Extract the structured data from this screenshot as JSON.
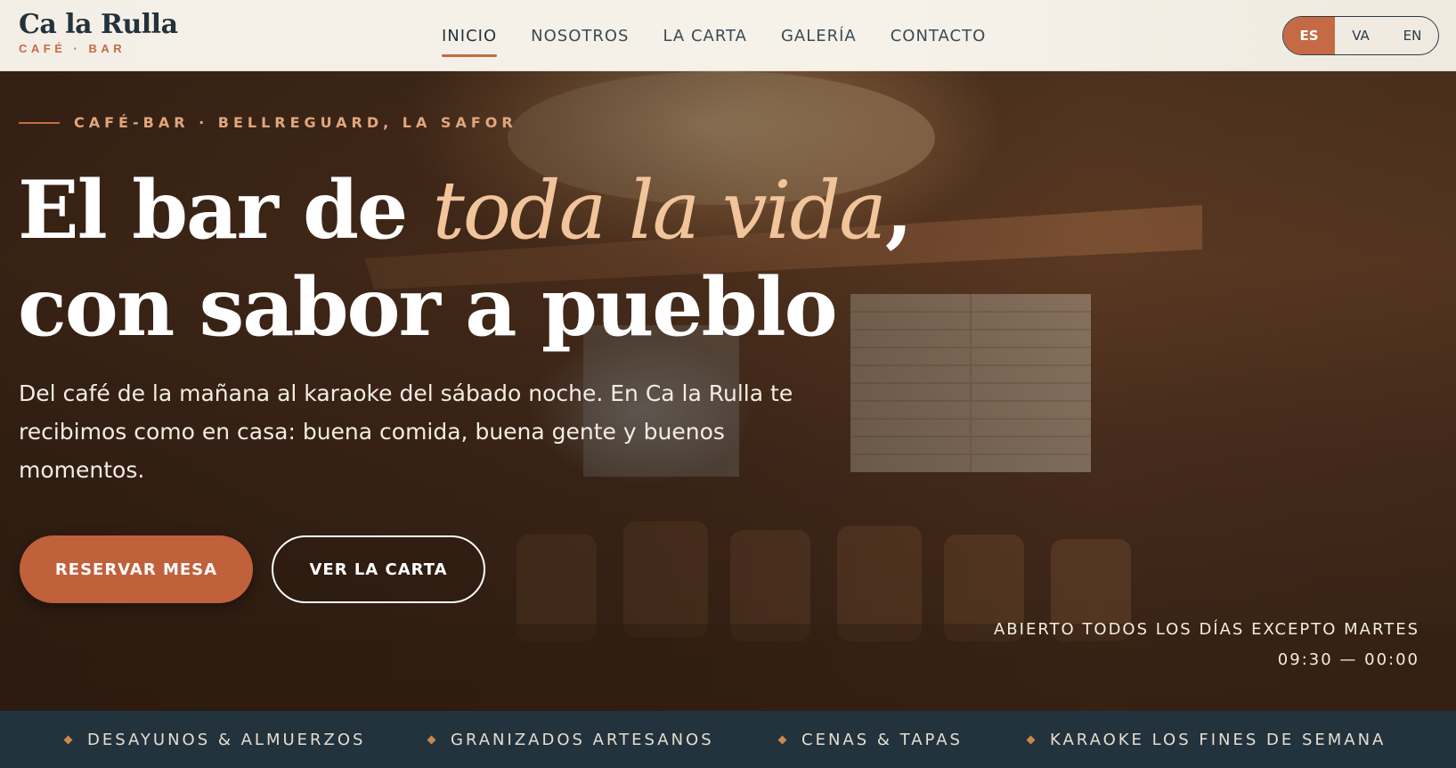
{
  "brand": {
    "name": "Ca la Rulla",
    "subtitle": "CAFÉ · BAR"
  },
  "nav": {
    "items": [
      {
        "label": "INICIO",
        "active": true
      },
      {
        "label": "NOSOTROS",
        "active": false
      },
      {
        "label": "LA CARTA",
        "active": false
      },
      {
        "label": "GALERÍA",
        "active": false
      },
      {
        "label": "CONTACTO",
        "active": false
      }
    ]
  },
  "language": {
    "options": [
      "ES",
      "VA",
      "EN"
    ],
    "selected": "ES"
  },
  "hero": {
    "eyebrow": "CAFÉ-BAR · BELLREGUARD, LA SAFOR",
    "headline": {
      "part1": "El bar de ",
      "accent": "toda la vida",
      "part2": ",",
      "line2": "con sabor a pueblo"
    },
    "lead": "Del café de la mañana al karaoke del sábado noche. En Ca la Rulla te recibimos como en casa: buena comida, buena gente y buenos momentos.",
    "primary_button": "RESERVAR MESA",
    "secondary_button": "VER LA CARTA",
    "hours": {
      "days": "ABIERTO TODOS LOS DÍAS EXCEPTO MARTES",
      "time": "09:30 — 00:00"
    }
  },
  "features": [
    "DESAYUNOS & ALMUERZOS",
    "GRANIZADOS ARTESANOS",
    "CENAS & TAPAS",
    "KARAOKE LOS FINES DE SEMANA"
  ],
  "colors": {
    "accent": "#c56a45",
    "dark": "#22333e",
    "headline_accent": "#f2c49c"
  }
}
